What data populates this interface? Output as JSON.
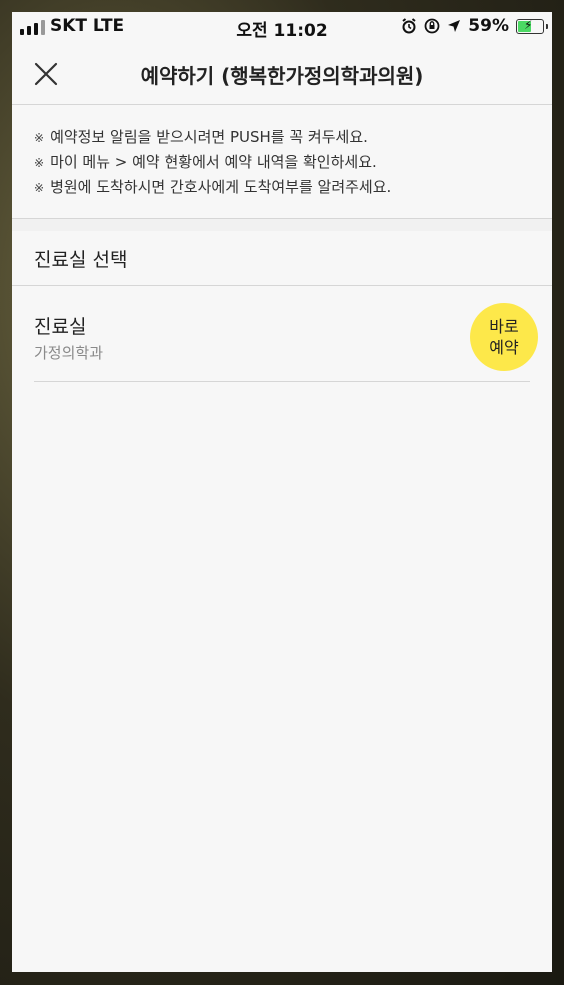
{
  "status_bar": {
    "carrier": "SKT LTE",
    "time": "오전 11:02",
    "battery_percent": "59%",
    "battery_level": 0.59,
    "icons": [
      "signal-icon",
      "alarm-icon",
      "orientation-lock-icon",
      "location-arrow-icon",
      "battery-charging-icon"
    ]
  },
  "navbar": {
    "title": "예약하기 (행복한가정의학과의원)",
    "close_icon": "close-icon"
  },
  "notices": [
    "예약정보 알림을 받으시려면 PUSH를 꼭 켜두세요.",
    "마이 메뉴 > 예약 현황에서 예약 내역을 확인하세요.",
    "병원에 도착하시면 간호사에게 도착여부를 알려주세요."
  ],
  "notice_mark": "※",
  "section": {
    "title": "진료실 선택"
  },
  "rooms": [
    {
      "name": "진료실",
      "department": "가정의학과",
      "button_line1": "바로",
      "button_line2": "예약"
    }
  ],
  "colors": {
    "accent_button": "#fde84a",
    "background": "#f7f7f7",
    "divider": "#d6d6d6",
    "battery_fill": "#4cd964"
  }
}
